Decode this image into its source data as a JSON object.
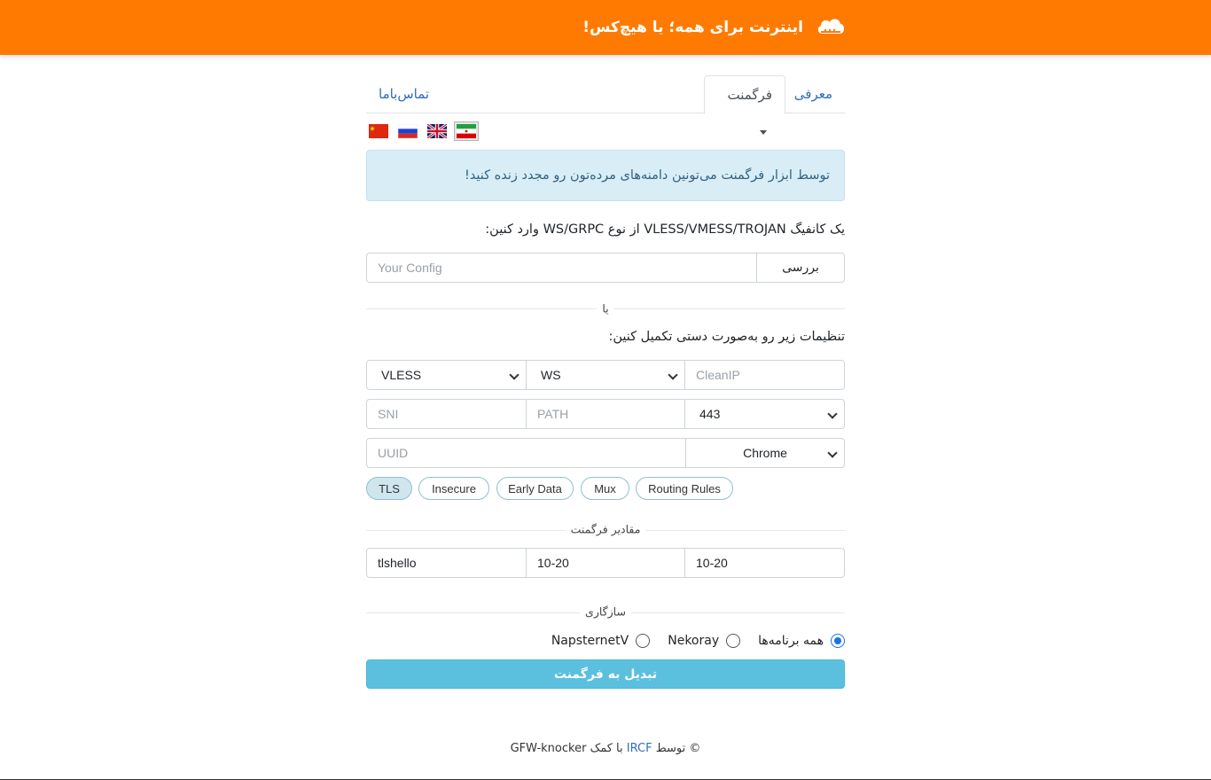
{
  "header": {
    "title": "اینترنت برای همه؛ یا هیچ‌کس!",
    "logo_icon": "cloud-icon",
    "bg_color": "#ff7a00"
  },
  "tabs": [
    {
      "label": "معرفی",
      "active": false
    },
    {
      "label": "فرگمنت",
      "active": true,
      "dropdown": true
    },
    {
      "label": "تماس‌باما",
      "active": false
    }
  ],
  "languages": [
    {
      "name": "Persian",
      "icon": "iran-flag-icon",
      "selected": true
    },
    {
      "name": "English",
      "icon": "uk-flag-icon",
      "selected": false
    },
    {
      "name": "Russian",
      "icon": "russia-flag-icon",
      "selected": false
    },
    {
      "name": "Chinese",
      "icon": "china-flag-icon",
      "selected": false
    }
  ],
  "alert": {
    "text": "توسط ابزار فرگمنت می‌تونین دامنه‌های مرده‌تون رو مجدد زنده کنید!"
  },
  "config_section": {
    "label": "یک کانفیگ VLESS/VMESS/TROJAN از نوع WS/GRPC وارد کنین:",
    "input_placeholder": "Your Config",
    "input_value": "",
    "check_button": "بررسی"
  },
  "or_divider": "یا",
  "manual_section": {
    "label": "تنظیمات زیر رو به‌صورت دستی تکمیل کنین:",
    "protocol": "VLESS",
    "transport": "WS",
    "clean_ip_placeholder": "CleanIP",
    "sni_placeholder": "SNI",
    "path_placeholder": "PATH",
    "port": "443",
    "uuid_placeholder": "UUID",
    "fingerprint": "Chrome"
  },
  "toggles": [
    {
      "label": "TLS",
      "active": true
    },
    {
      "label": "Insecure",
      "active": false
    },
    {
      "label": "Early Data",
      "active": false
    },
    {
      "label": "Mux",
      "active": false
    },
    {
      "label": "Routing Rules",
      "active": false
    }
  ],
  "fragment_section": {
    "title": "مقادیر فرگمنت",
    "packets": "tlshello",
    "length": "10-20",
    "interval": "10-20"
  },
  "compat_section": {
    "title": "سازگاری",
    "options": [
      {
        "label": "همه برنامه‌ها",
        "checked": true
      },
      {
        "label": "Nekoray",
        "checked": false
      },
      {
        "label": "NapsternetV",
        "checked": false
      }
    ]
  },
  "convert_button": "تبدیل به فرگمنت",
  "footer": {
    "prefix": "© توسط",
    "org": "IRCF",
    "middle": "با کمک",
    "project": "GFW-knocker"
  }
}
